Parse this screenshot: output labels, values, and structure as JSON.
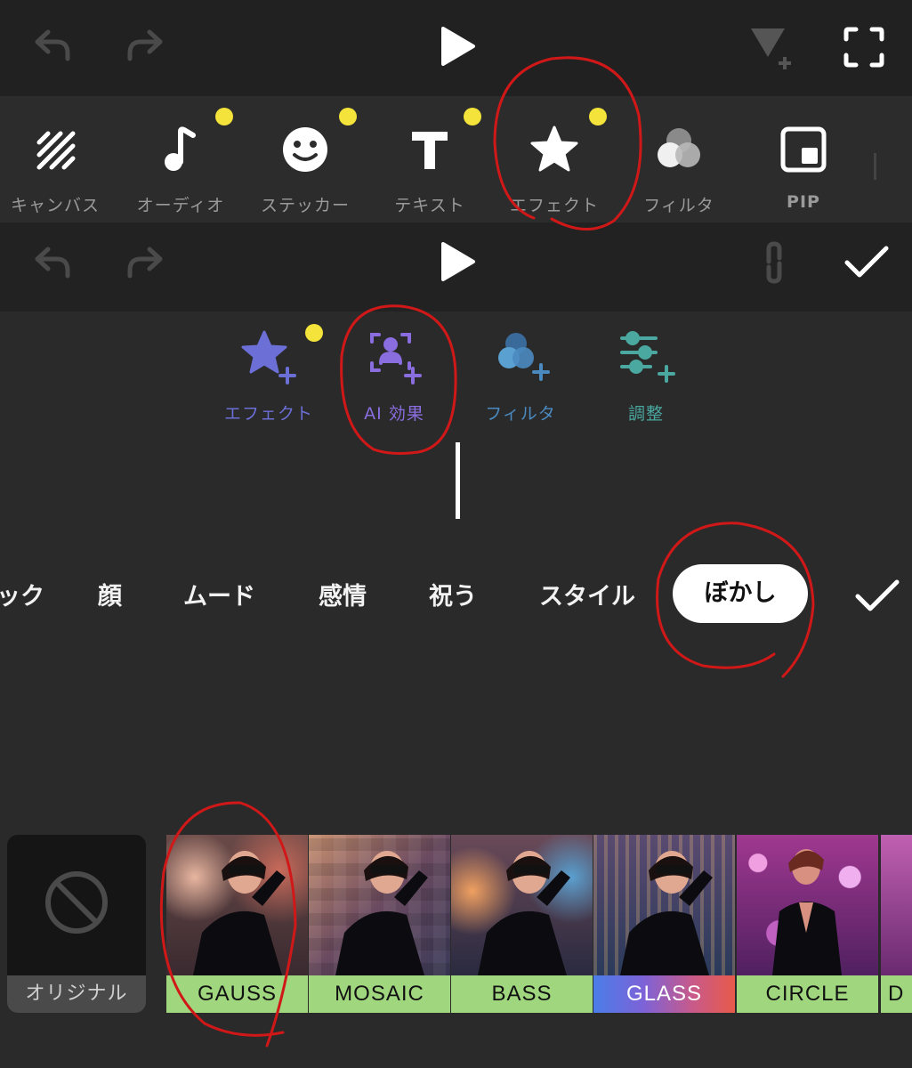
{
  "top_panel": {
    "icons": {
      "undo": "undo-icon",
      "redo": "redo-icon",
      "play": "play-icon",
      "keyframe": "keyframe-add-icon",
      "fullscreen": "fullscreen-icon"
    },
    "tools": [
      {
        "label": "キャンバス",
        "icon": "canvas-icon",
        "dot": false
      },
      {
        "label": "オーディオ",
        "icon": "music-note-icon",
        "dot": true
      },
      {
        "label": "ステッカー",
        "icon": "smiley-icon",
        "dot": true
      },
      {
        "label": "テキスト",
        "icon": "text-icon",
        "dot": true
      },
      {
        "label": "エフェクト",
        "icon": "star-icon",
        "dot": true
      },
      {
        "label": "フィルタ",
        "icon": "filter-circles-icon",
        "dot": false
      },
      {
        "label": "PIP",
        "icon": "pip-icon",
        "dot": false
      }
    ],
    "accent_dot_color": "#f3e33a"
  },
  "effect_panel": {
    "icons": {
      "undo": "undo-icon",
      "redo": "redo-icon",
      "play": "play-icon",
      "link": "link-icon",
      "confirm": "checkmark-icon"
    },
    "tools": [
      {
        "label": "エフェクト",
        "icon": "star-plus-icon",
        "color": "#6b6fd6"
      },
      {
        "label": "AI 効果",
        "icon": "ai-person-plus-icon",
        "color": "#8a6ee0"
      },
      {
        "label": "フィルタ",
        "icon": "filter-plus-icon",
        "color": "#4a8ac0"
      },
      {
        "label": "調整",
        "icon": "adjust-sliders-icon",
        "color": "#4aa8a0"
      }
    ]
  },
  "category_bar": {
    "items": [
      "ック",
      "顔",
      "ムード",
      "感情",
      "祝う",
      "スタイル"
    ],
    "selected": "ぼかし",
    "confirm_icon": "checkmark-icon"
  },
  "effects": {
    "original_label": "オリジナル",
    "items": [
      "GAUSS",
      "MOSAIC",
      "BASS",
      "GLASS",
      "CIRCLE",
      "D"
    ]
  }
}
